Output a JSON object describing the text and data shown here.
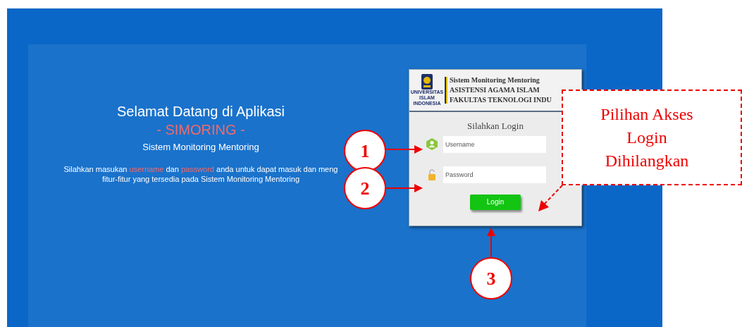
{
  "welcome": {
    "title": "Selamat Datang di Aplikasi",
    "app_name": "- SIMORING -",
    "subtitle": "Sistem Monitoring Mentoring",
    "instructions": [
      {
        "segments": [
          {
            "text": "Silahkan masukan ",
            "highlight": false
          },
          {
            "text": "username",
            "highlight": true
          },
          {
            "text": " dan ",
            "highlight": false
          },
          {
            "text": "password",
            "highlight": true
          },
          {
            "text": " anda untuk dapat masuk dan meng",
            "highlight": false
          }
        ]
      },
      {
        "segments": [
          {
            "text": "fitur-fitur yang tersedia pada Sistem Monitoring Mentoring",
            "highlight": false
          }
        ]
      }
    ]
  },
  "login_card": {
    "logo_text": [
      "UNIVERSITAS",
      "ISLAM",
      "INDONESIA"
    ],
    "header_lines": [
      "Sistem Monitoring Mentoring",
      "ASISTENSI AGAMA ISLAM",
      "FAKULTAS TEKNOLOGI INDU"
    ],
    "heading": "Silahkan Login",
    "fields": [
      {
        "kind": "text",
        "placeholder": "Username"
      },
      {
        "kind": "password",
        "placeholder": "Password"
      }
    ],
    "button": "Login"
  },
  "annotations": {
    "callouts": [
      "1",
      "2",
      "3"
    ],
    "note": [
      "Pilihan Akses",
      "Login",
      "Dihilangkan"
    ]
  }
}
